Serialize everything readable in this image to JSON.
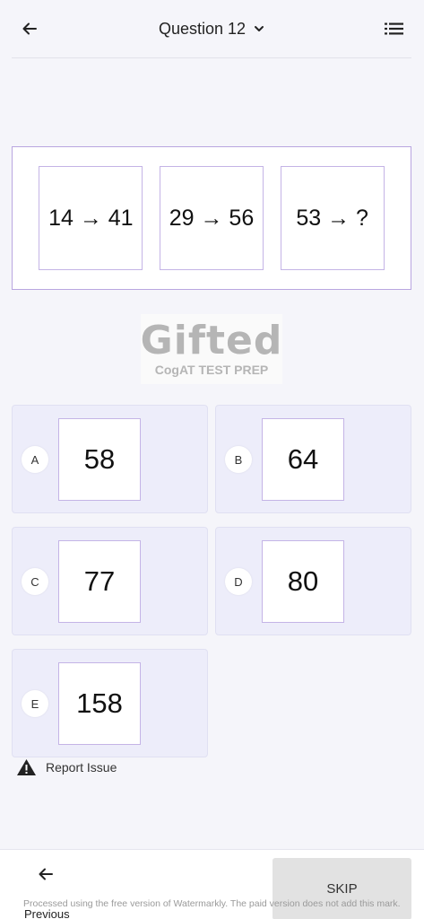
{
  "header": {
    "title": "Question 12",
    "back_icon": "arrow-left-icon",
    "dropdown_icon": "chevron-down-icon",
    "list_icon": "list-icon"
  },
  "question": {
    "pairs": [
      "14 → 41",
      "29 → 56",
      "53 → ?"
    ]
  },
  "logo": {
    "main": "Gifted",
    "sub": "CogAT TEST PREP"
  },
  "options": [
    {
      "letter": "A",
      "value": "58"
    },
    {
      "letter": "B",
      "value": "64"
    },
    {
      "letter": "C",
      "value": "77"
    },
    {
      "letter": "D",
      "value": "80"
    },
    {
      "letter": "E",
      "value": "158"
    }
  ],
  "report": {
    "label": "Report Issue",
    "icon": "warning-icon"
  },
  "footer": {
    "previous_label": "Previous",
    "skip_label": "SKIP",
    "watermark": "Processed using the free version of Watermarkly. The paid version does not add this mark."
  },
  "colors": {
    "accent_border": "#b9a6e0",
    "option_bg": "#ededfa",
    "page_bg": "#f5f5fa"
  }
}
